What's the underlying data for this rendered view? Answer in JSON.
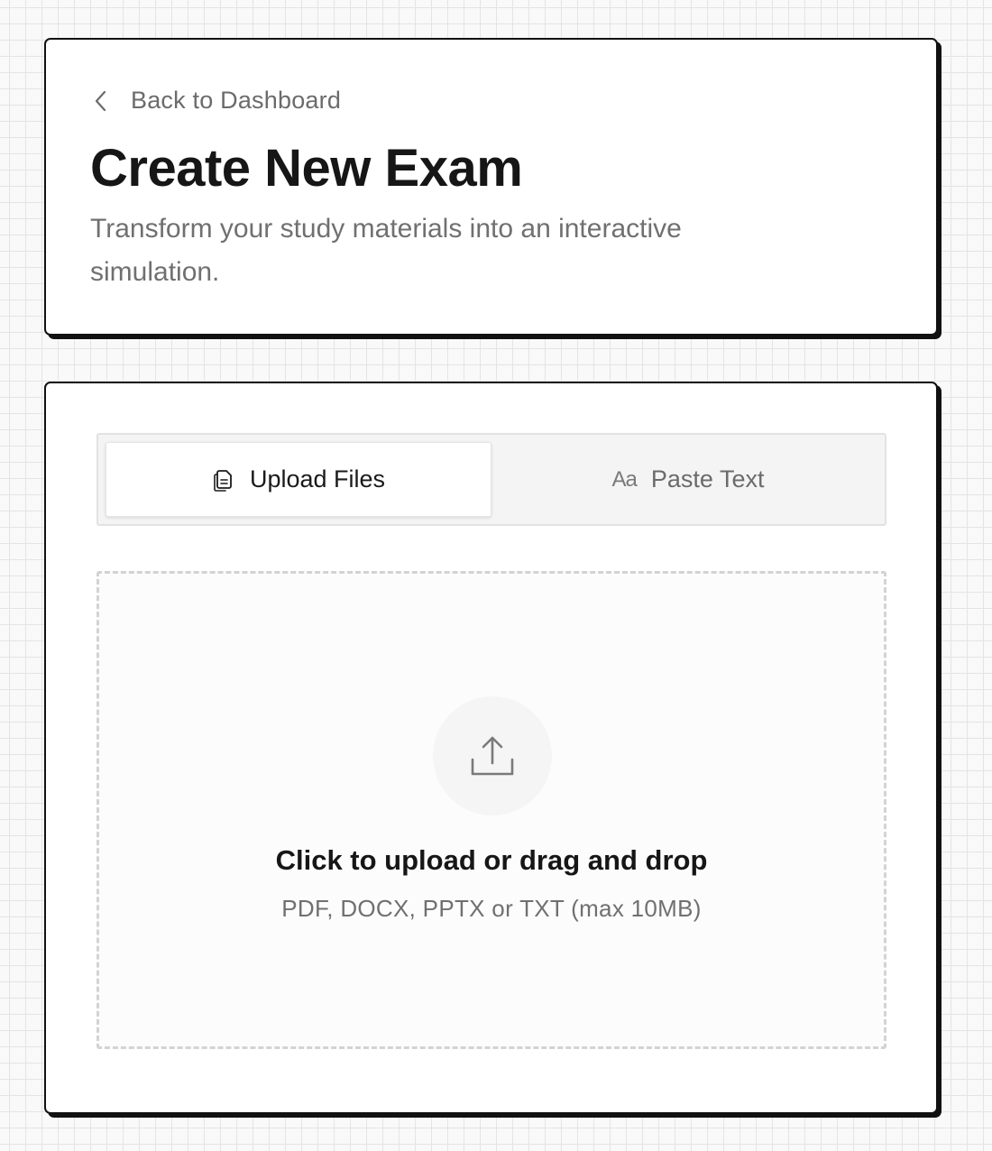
{
  "header": {
    "back_link_label": "Back to Dashboard",
    "back_icon": "chevron-left-icon",
    "title": "Create New Exam",
    "subtitle": "Transform your study materials into an interactive simulation."
  },
  "tabs": [
    {
      "label": "Upload Files",
      "icon": "document-icon",
      "active": true
    },
    {
      "label": "Paste Text",
      "icon": "text-icon",
      "icon_glyph": "Aa",
      "active": false
    }
  ],
  "dropzone": {
    "icon": "upload-icon",
    "title": "Click to upload or drag and drop",
    "hint": "PDF, DOCX, PPTX or TXT (max 10MB)"
  },
  "colors": {
    "card_border": "#111111",
    "muted_text": "#707070",
    "heading_text": "#161616",
    "dropzone_border": "#d3d3d3"
  }
}
